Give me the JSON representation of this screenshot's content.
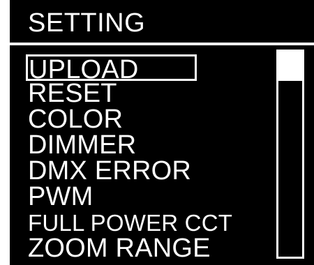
{
  "header": {
    "title": "SETTING"
  },
  "menu": {
    "selected_index": 0,
    "items": [
      {
        "label": "UPLOAD"
      },
      {
        "label": "RESET"
      },
      {
        "label": "COLOR"
      },
      {
        "label": "DIMMER"
      },
      {
        "label": "DMX ERROR"
      },
      {
        "label": "PWM"
      },
      {
        "label": "FULL POWER CCT"
      },
      {
        "label": "ZOOM RANGE"
      }
    ]
  },
  "scrollbar": {
    "thumb_position_fraction": 0.0
  },
  "colors": {
    "background": "#000000",
    "foreground": "#ffffff"
  }
}
